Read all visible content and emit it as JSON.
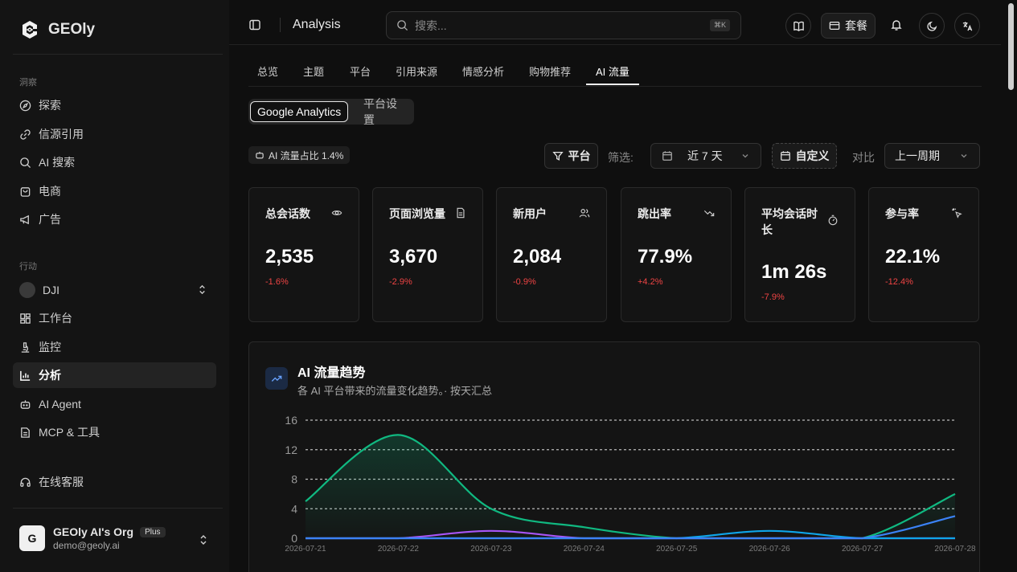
{
  "brand": {
    "name": "GEOly"
  },
  "sidebar": {
    "sections": {
      "insights": "洞察",
      "actions": "行动"
    },
    "insight_items": [
      {
        "label": "探索",
        "icon": "compass-icon"
      },
      {
        "label": "信源引用",
        "icon": "link-icon"
      },
      {
        "label": "AI 搜索",
        "icon": "search-icon"
      },
      {
        "label": "电商",
        "icon": "shopping-bag-icon"
      },
      {
        "label": "广告",
        "icon": "megaphone-icon"
      }
    ],
    "brand_selector": "DJI",
    "action_items": [
      {
        "label": "工作台",
        "icon": "dashboard-icon"
      },
      {
        "label": "监控",
        "icon": "microscope-icon"
      },
      {
        "label": "分析",
        "icon": "bar-chart-icon",
        "active": true
      },
      {
        "label": "AI Agent",
        "icon": "bot-icon"
      },
      {
        "label": "MCP & 工具",
        "icon": "document-icon"
      }
    ],
    "support": "在线客服",
    "org": {
      "initial": "G",
      "name": "GEOly AI's Org",
      "badge": "Plus",
      "email": "demo@geoly.ai"
    }
  },
  "topbar": {
    "title": "Analysis",
    "search_placeholder": "搜索...",
    "shortcut": "⌘K",
    "plan_label": "套餐"
  },
  "tabs": [
    "总览",
    "主题",
    "平台",
    "引用来源",
    "情感分析",
    "购物推荐",
    "AI 流量"
  ],
  "active_tab": "AI 流量",
  "segments": [
    "Google Analytics",
    "平台设置"
  ],
  "filters": {
    "ai_share": "AI 流量占比 1.4%",
    "platform_btn": "平台",
    "filter_label": "筛选:",
    "range": "近 7 天",
    "custom": "自定义",
    "compare_label": "对比",
    "compare_value": "上一周期"
  },
  "metrics": [
    {
      "title": "总会话数",
      "value": "2,535",
      "delta": "-1.6%",
      "icon": "eye-icon"
    },
    {
      "title": "页面浏览量",
      "value": "3,670",
      "delta": "-2.9%",
      "icon": "file-icon"
    },
    {
      "title": "新用户",
      "value": "2,084",
      "delta": "-0.9%",
      "icon": "users-icon"
    },
    {
      "title": "跳出率",
      "value": "77.9%",
      "delta": "+4.2%",
      "icon": "trend-down-icon"
    },
    {
      "title": "平均会话时长",
      "value": "1m 26s",
      "delta": "-7.9%",
      "icon": "timer-icon"
    },
    {
      "title": "参与率",
      "value": "22.1%",
      "delta": "-12.4%",
      "icon": "sparkle-click-icon"
    }
  ],
  "trend": {
    "title": "AI 流量趋势",
    "subtitle": "各 AI 平台带来的流量变化趋势。· 按天汇总"
  },
  "colors": {
    "green": "#10b981",
    "purple": "#a855f7",
    "blue": "#3b82f6",
    "cyan": "#0ea5e9",
    "negative": "#ef4444"
  },
  "chart_data": {
    "type": "line",
    "x": [
      "2026-07-21",
      "2026-07-22",
      "2026-07-23",
      "2026-07-24",
      "2026-07-25",
      "2026-07-26",
      "2026-07-27",
      "2026-07-28"
    ],
    "ylim": [
      0,
      16
    ],
    "yticks": [
      0,
      4,
      8,
      12,
      16
    ],
    "grid": true,
    "series": [
      {
        "values": [
          5,
          14,
          4,
          1.5,
          0,
          0,
          0,
          6
        ],
        "color": "#10b981",
        "area": true
      },
      {
        "values": [
          0,
          0,
          1,
          0,
          0,
          0,
          0,
          0
        ],
        "color": "#a855f7"
      },
      {
        "values": [
          0,
          0,
          0,
          0,
          0,
          1,
          0,
          0
        ],
        "color": "#0ea5e9"
      },
      {
        "values": [
          0,
          0,
          0,
          0,
          0,
          0,
          0,
          3
        ],
        "color": "#3b82f6"
      }
    ]
  }
}
